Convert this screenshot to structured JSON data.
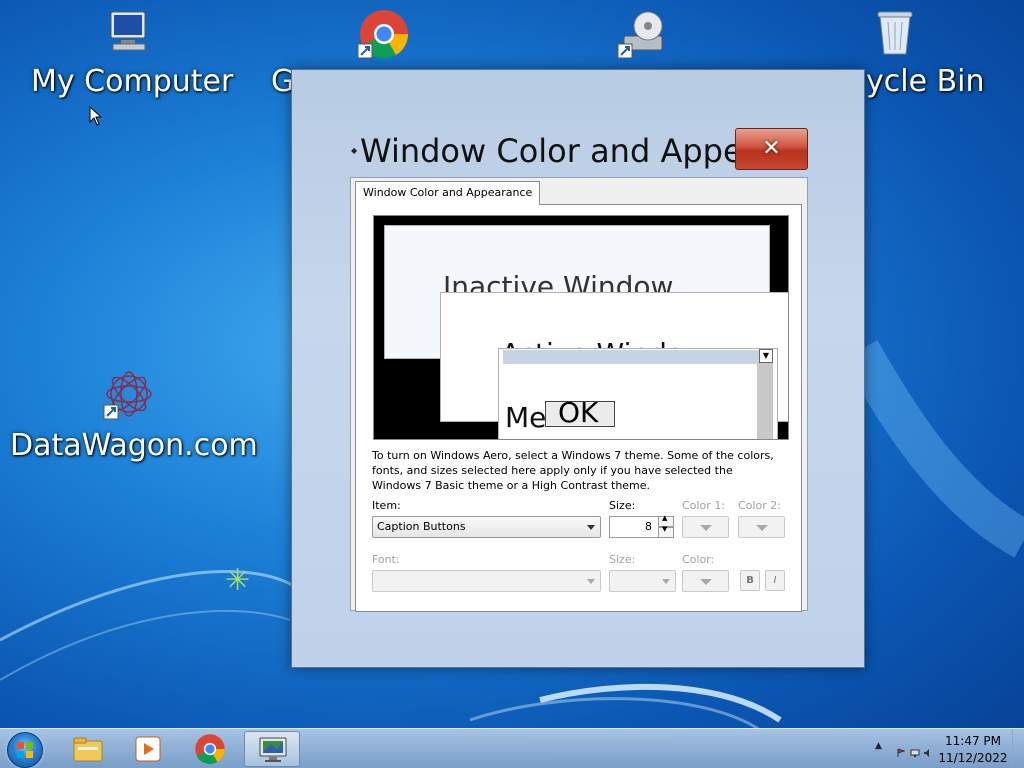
{
  "desktop": {
    "icons": [
      {
        "label": "My Computer",
        "icon": "computer-icon"
      },
      {
        "label": "G",
        "icon": "chrome-icon"
      },
      {
        "label": "",
        "icon": "disc-drive-shortcut-icon"
      },
      {
        "label": "ycle Bin",
        "icon": "recycle-bin-icon"
      },
      {
        "label": "DataWagon.com",
        "icon": "datawagon-shortcut-icon"
      }
    ]
  },
  "dialog": {
    "title": "Window Color and Appe...",
    "close_label": "✕",
    "tab_label": "Window Color and Appearance",
    "preview": {
      "inactive_title": "Inactive Window",
      "active_title": "Active Window",
      "message_title": "Me",
      "ok_label": "OK"
    },
    "info_text": "To turn on Windows Aero, select a Windows 7 theme.  Some of the colors, fonts, and sizes selected here apply only if you have selected the Windows 7 Basic theme or a High Contrast theme.",
    "item_label": "Item:",
    "item_value": "Caption Buttons",
    "size_label": "Size:",
    "size_value": "8",
    "color1_label": "Color 1:",
    "color2_label": "Color 2:",
    "font_label": "Font:",
    "font_value": "",
    "font_size_label": "Size:",
    "font_color_label": "Color:",
    "bold_label": "B",
    "italic_label": "I"
  },
  "taskbar": {
    "pinned": [
      {
        "icon": "explorer-icon"
      },
      {
        "icon": "media-player-icon"
      },
      {
        "icon": "chrome-icon"
      },
      {
        "icon": "display-settings-icon",
        "active": true
      }
    ],
    "clock_time": "11:47 PM",
    "clock_date": "11/12/2022"
  },
  "colors": {
    "desktop_blue": "#1c7fd6",
    "close_red": "#c7472f",
    "dialog_frame": "#c6d7ec"
  }
}
